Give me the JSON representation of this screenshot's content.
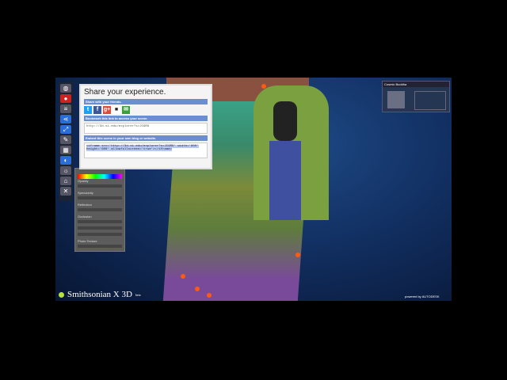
{
  "share_dialog": {
    "title": "Share your experience.",
    "friends_label": "Share with your friends.",
    "social": [
      {
        "name": "twitter",
        "glyph": "t",
        "color": "#1da1f2"
      },
      {
        "name": "facebook",
        "glyph": "f",
        "color": "#3b5998"
      },
      {
        "name": "google-plus",
        "glyph": "g+",
        "color": "#dd4b39"
      },
      {
        "name": "delicious",
        "glyph": "■",
        "color": "#222222"
      },
      {
        "name": "email",
        "glyph": "✉",
        "color": "#3aa03a"
      }
    ],
    "bookmark_label": "Bookmark this link to access your scene.",
    "bookmark_url": "http://3d.si.edu/explorer?s=JC9RG",
    "embed_label": "Embed this scene in your own blog or website.",
    "embed_code": "<iframe src='http://3d.si.edu/explorer?s=JC9RG' width='800' height='600' allowfullscreen='true'></iframe>"
  },
  "panel": {
    "opacity": "Opacity",
    "specularity": "Specularity",
    "reflection": "Reflection",
    "occlusion": "Occlusion",
    "photo_texture": "Photo Texture"
  },
  "nav": {
    "title": "Cosmic Buddha"
  },
  "branding": {
    "logo": "Smithsonian X 3D",
    "beta": "beta",
    "powered_by": "powered by AUTODESK"
  }
}
